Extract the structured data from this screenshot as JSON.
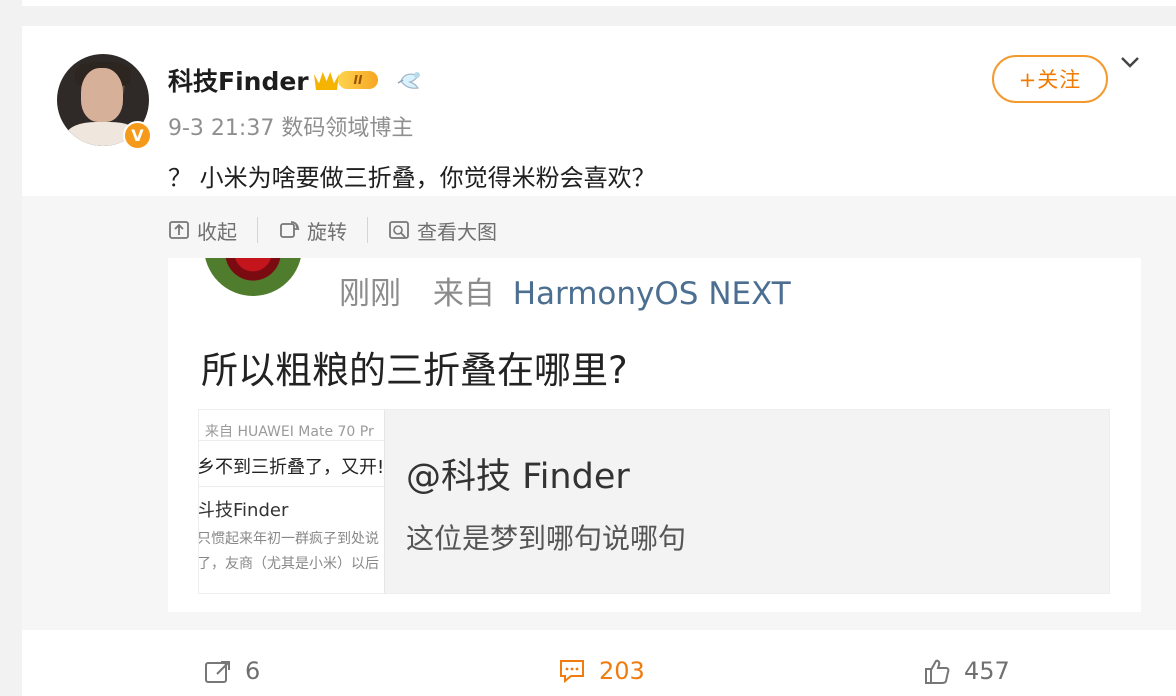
{
  "post": {
    "username": "科技Finder",
    "vip_rank": "II",
    "meta": "9-3 21:37 数码领域博主",
    "follow_label": "+关注",
    "text": "？ 小米为啥要做三折叠，你觉得米粉会喜欢？"
  },
  "media_tools": [
    {
      "label": "收起",
      "icon": "collapse-icon"
    },
    {
      "label": "旋转",
      "icon": "rotate-icon"
    },
    {
      "label": "查看大图",
      "icon": "view-large-icon"
    }
  ],
  "preview": {
    "meta_time": "刚刚",
    "meta_from": "来自",
    "meta_os": "HarmonyOS NEXT",
    "title": "所以粗粮的三折叠在哪里?",
    "embed_left": {
      "line1": "来自 HUAWEI Mate 70 Pr",
      "line2": "乡不到三折叠了，又开!",
      "line3": "斗技Finder",
      "line4": "只惯起来年初一群疯子到处说",
      "line5": "了，友商（尤其是小米）以后"
    },
    "embed_name": "@科技 Finder",
    "embed_sub": "这位是梦到哪句说哪句"
  },
  "actions": {
    "repost_count": "6",
    "comment_count": "203",
    "like_count": "457"
  },
  "colors": {
    "accent": "#f07b00",
    "verified": "#f59a1b"
  }
}
